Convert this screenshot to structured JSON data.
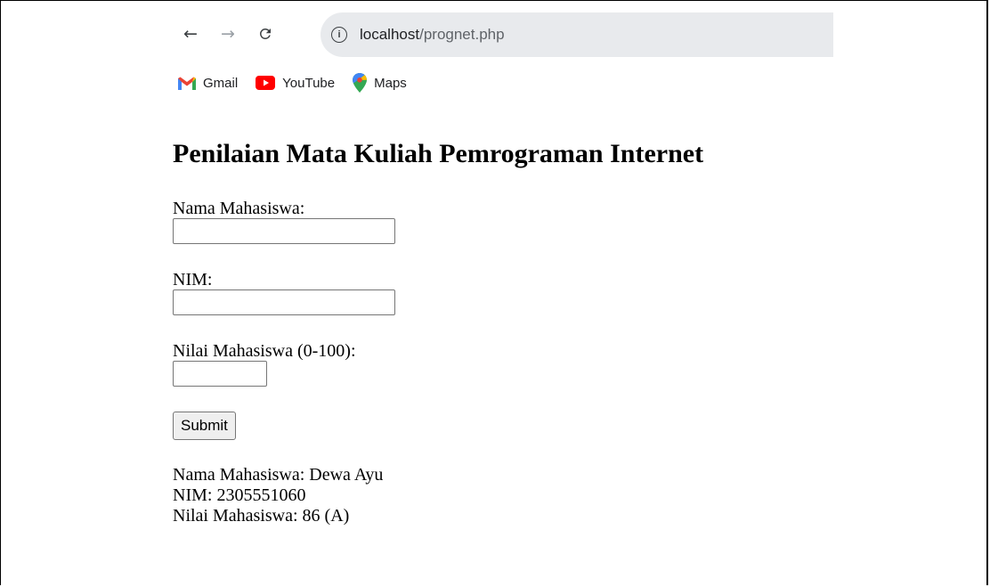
{
  "browser": {
    "url_host": "localhost",
    "url_path": "/prognet.php",
    "bookmarks": [
      {
        "label": "Gmail",
        "icon": "gmail-icon"
      },
      {
        "label": "YouTube",
        "icon": "youtube-icon"
      },
      {
        "label": "Maps",
        "icon": "maps-icon"
      }
    ]
  },
  "page": {
    "title": "Penilaian Mata Kuliah Pemrograman Internet",
    "form": {
      "name_label": "Nama Mahasiswa:",
      "name_value": "",
      "nim_label": "NIM:",
      "nim_value": "",
      "score_label": "Nilai Mahasiswa (0-100):",
      "score_value": "",
      "submit_label": "Submit"
    },
    "result": {
      "name_line": "Nama Mahasiswa: Dewa Ayu",
      "nim_line": "NIM: 2305551060",
      "score_line": "Nilai Mahasiswa: 86 (A)"
    }
  },
  "colors": {
    "address_bar": "#e8eaed",
    "gmail_red": "#ea4335",
    "youtube_red": "#ff0000"
  }
}
